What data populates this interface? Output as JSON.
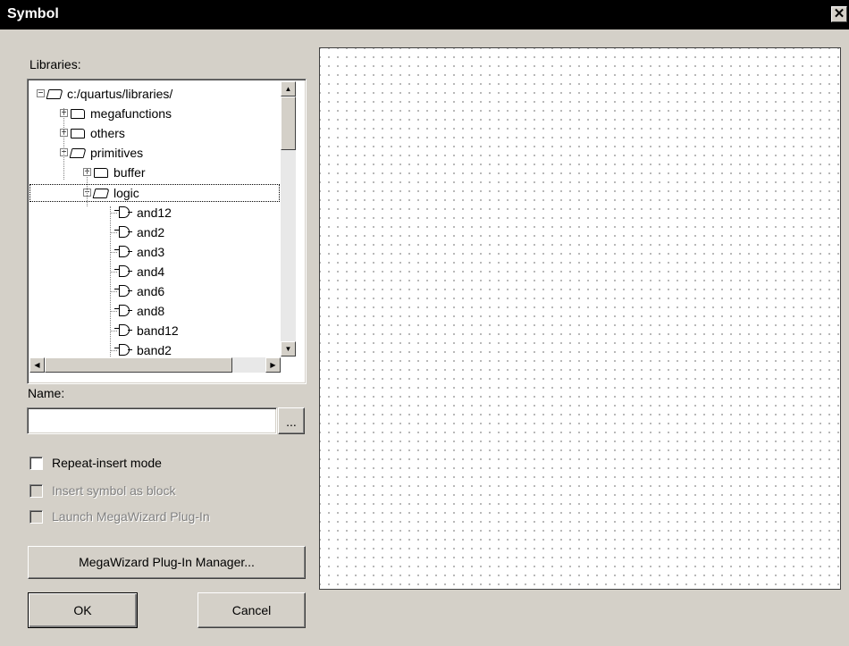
{
  "window": {
    "title": "Symbol",
    "close_glyph": "✕"
  },
  "libraries": {
    "label": "Libraries:",
    "tree": [
      {
        "label": "c:/quartus/libraries/",
        "expander": "−",
        "icon": "folder-open-icon"
      },
      {
        "label": "megafunctions",
        "expander": "+",
        "icon": "folder-icon"
      },
      {
        "label": "others",
        "expander": "+",
        "icon": "folder-icon"
      },
      {
        "label": "primitives",
        "expander": "−",
        "icon": "folder-open-icon"
      },
      {
        "label": "buffer",
        "expander": "+",
        "icon": "folder-icon"
      },
      {
        "label": "logic",
        "expander": "−",
        "icon": "folder-open-icon",
        "selected": true
      },
      {
        "label": "and12",
        "icon": "gate-icon"
      },
      {
        "label": "and2",
        "icon": "gate-icon"
      },
      {
        "label": "and3",
        "icon": "gate-icon"
      },
      {
        "label": "and4",
        "icon": "gate-icon"
      },
      {
        "label": "and6",
        "icon": "gate-icon"
      },
      {
        "label": "and8",
        "icon": "gate-icon"
      },
      {
        "label": "band12",
        "icon": "gate-icon"
      },
      {
        "label": "band2",
        "icon": "gate-icon"
      }
    ]
  },
  "name": {
    "label": "Name:",
    "value": "",
    "browse_label": "..."
  },
  "options": {
    "repeat_insert": {
      "label": "Repeat-insert mode",
      "checked": false,
      "enabled": true
    },
    "insert_as_block": {
      "label": "Insert symbol as block",
      "checked": false,
      "enabled": false
    },
    "launch_megawizard": {
      "label": "Launch MegaWizard Plug-In",
      "checked": false,
      "enabled": false
    }
  },
  "buttons": {
    "megawizard_manager": "MegaWizard Plug-In Manager...",
    "ok": "OK",
    "cancel": "Cancel"
  },
  "scroll_glyphs": {
    "up": "▲",
    "down": "▼",
    "left": "◀",
    "right": "▶"
  }
}
